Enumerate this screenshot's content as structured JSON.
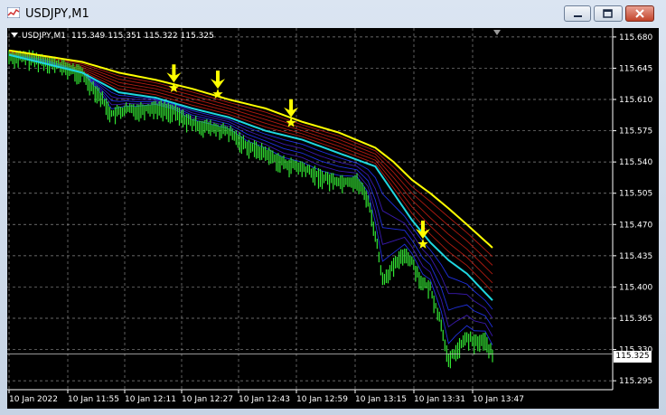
{
  "window": {
    "title": "USDJPY,M1",
    "buttons": [
      "minimize",
      "restore",
      "close"
    ]
  },
  "chart_header": {
    "symbol": "USDJPY,M1",
    "ohlc": [
      "115.349",
      "115.351",
      "115.322",
      "115.325"
    ]
  },
  "current_price": "115.325",
  "colors": {
    "background": "#000000",
    "grid": "#8a8a8a",
    "candles": "#33e633",
    "candles_low": "#2b3cff",
    "upper_band": "#ffff00",
    "cyan_line": "#1fd7e0",
    "ribbon_red": "#b01a10",
    "signal_arrow": "#ffff00"
  },
  "chart_data": {
    "type": "line",
    "y_ticks": [
      "115.680",
      "115.645",
      "115.610",
      "115.575",
      "115.540",
      "115.505",
      "115.470",
      "115.435",
      "115.400",
      "115.365",
      "115.330",
      "115.295"
    ],
    "x_ticks": [
      "10 Jan 2022",
      "10 Jan 11:55",
      "10 Jan 12:11",
      "10 Jan 12:27",
      "10 Jan 12:43",
      "10 Jan 12:59",
      "10 Jan 13:15",
      "10 Jan 13:31",
      "10 Jan 13:47"
    ],
    "ylim": [
      115.285,
      115.69
    ],
    "x_range": [
      0,
      132
    ],
    "grid": true,
    "series": [
      {
        "key": "price",
        "x": [
          0,
          5,
          10,
          15,
          20,
          25,
          28,
          32,
          35,
          40,
          45,
          50,
          55,
          60,
          65,
          70,
          75,
          80,
          85,
          90,
          95,
          98,
          100,
          102,
          105,
          108,
          110,
          113,
          115,
          118,
          120,
          122,
          125,
          127,
          130,
          132
        ],
        "values": [
          115.66,
          115.658,
          115.655,
          115.648,
          115.64,
          115.615,
          115.595,
          115.6,
          115.6,
          115.603,
          115.598,
          115.585,
          115.58,
          115.575,
          115.56,
          115.552,
          115.54,
          115.535,
          115.525,
          115.52,
          115.52,
          115.5,
          115.46,
          115.41,
          115.425,
          115.44,
          115.43,
          115.405,
          115.4,
          115.36,
          115.318,
          115.33,
          115.345,
          115.34,
          115.342,
          115.325
        ]
      },
      {
        "key": "upper",
        "x": [
          0,
          20,
          30,
          40,
          50,
          60,
          70,
          80,
          90,
          100,
          105,
          110,
          115,
          120,
          125,
          132
        ],
        "values": [
          115.665,
          115.652,
          115.64,
          115.632,
          115.622,
          115.61,
          115.6,
          115.585,
          115.573,
          115.556,
          115.54,
          115.52,
          115.505,
          115.488,
          115.47,
          115.444
        ]
      },
      {
        "key": "cyan",
        "x": [
          0,
          20,
          30,
          40,
          50,
          60,
          70,
          80,
          90,
          100,
          105,
          110,
          115,
          120,
          125,
          132
        ],
        "values": [
          115.66,
          115.64,
          115.618,
          115.612,
          115.6,
          115.59,
          115.575,
          115.565,
          115.55,
          115.535,
          115.505,
          115.475,
          115.45,
          115.43,
          115.415,
          115.385
        ]
      }
    ],
    "signals": [
      {
        "x": 45,
        "y": 115.625
      },
      {
        "x": 57,
        "y": 115.618
      },
      {
        "x": 77,
        "y": 115.586
      },
      {
        "x": 113,
        "y": 115.45
      }
    ]
  }
}
